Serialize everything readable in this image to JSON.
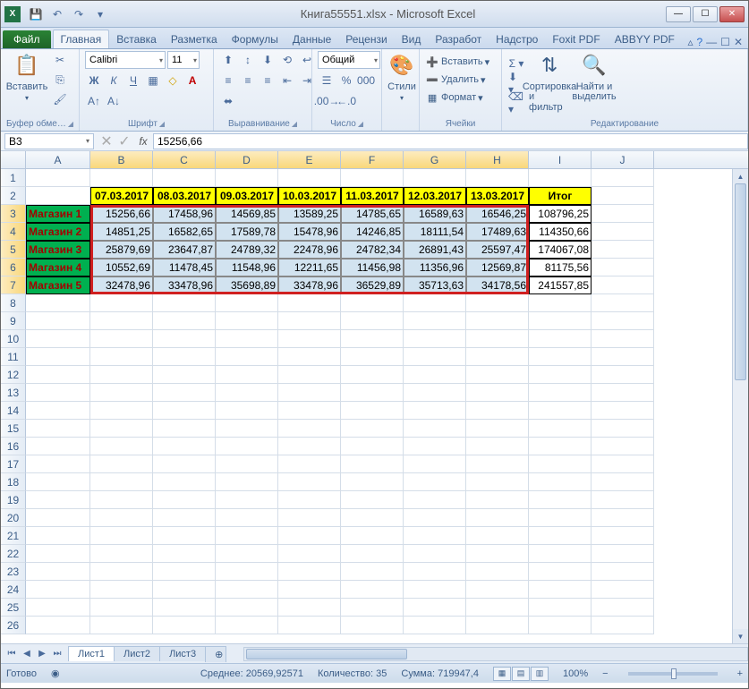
{
  "window": {
    "title": "Книга55551.xlsx - Microsoft Excel"
  },
  "tabs": {
    "file": "Файл",
    "items": [
      "Главная",
      "Вставка",
      "Разметка",
      "Формулы",
      "Данные",
      "Рецензи",
      "Вид",
      "Разработ",
      "Надстро",
      "Foxit PDF",
      "ABBYY PDF"
    ],
    "active": 0
  },
  "ribbon": {
    "paste": "Вставить",
    "clipboard_label": "Буфер обме…",
    "font_label": "Шрифт",
    "font_name": "Calibri",
    "font_size": "11",
    "align_label": "Выравнивание",
    "number_label": "Число",
    "number_format": "Общий",
    "styles": "Стили",
    "cells_label": "Ячейки",
    "insert": "Вставить",
    "delete": "Удалить",
    "format": "Формат",
    "editing_label": "Редактирование",
    "sort": "Сортировка",
    "sort2": "и фильтр",
    "find": "Найти и",
    "find2": "выделить"
  },
  "formula": {
    "cell_ref": "B3",
    "fx": "fx",
    "value": "15256,66"
  },
  "columns": [
    "A",
    "B",
    "C",
    "D",
    "E",
    "F",
    "G",
    "H",
    "I",
    "J"
  ],
  "rows": [
    "1",
    "2",
    "3",
    "4",
    "5",
    "6",
    "7",
    "8",
    "9",
    "10",
    "11",
    "12",
    "13",
    "14",
    "15",
    "16",
    "17",
    "18",
    "19",
    "20",
    "21",
    "22",
    "23",
    "24",
    "25",
    "26"
  ],
  "headers": {
    "dates": [
      "07.03.2017",
      "08.03.2017",
      "09.03.2017",
      "10.03.2017",
      "11.03.2017",
      "12.03.2017",
      "13.03.2017"
    ],
    "itog": "Итог"
  },
  "stores": [
    "Магазин 1",
    "Магазин 2",
    "Магазин 3",
    "Магазин 4",
    "Магазин 5"
  ],
  "data": [
    [
      "15256,66",
      "17458,96",
      "14569,85",
      "13589,25",
      "14785,65",
      "16589,63",
      "16546,25"
    ],
    [
      "14851,25",
      "16582,65",
      "17589,78",
      "15478,96",
      "14246,85",
      "18111,54",
      "17489,63"
    ],
    [
      "25879,69",
      "23647,87",
      "24789,32",
      "22478,96",
      "24782,34",
      "26891,43",
      "25597,47"
    ],
    [
      "10552,69",
      "11478,45",
      "11548,96",
      "12211,65",
      "11456,98",
      "11356,96",
      "12569,87"
    ],
    [
      "32478,96",
      "33478,96",
      "35698,89",
      "33478,96",
      "36529,89",
      "35713,63",
      "34178,56"
    ]
  ],
  "totals": [
    "108796,25",
    "114350,66",
    "174067,08",
    "81175,56",
    "241557,85"
  ],
  "sheets": {
    "items": [
      "Лист1",
      "Лист2",
      "Лист3"
    ],
    "active": 0
  },
  "status": {
    "ready": "Готово",
    "avg_label": "Среднее:",
    "avg": "20569,92571",
    "count_label": "Количество:",
    "count": "35",
    "sum_label": "Сумма:",
    "sum": "719947,4",
    "zoom": "100%"
  }
}
